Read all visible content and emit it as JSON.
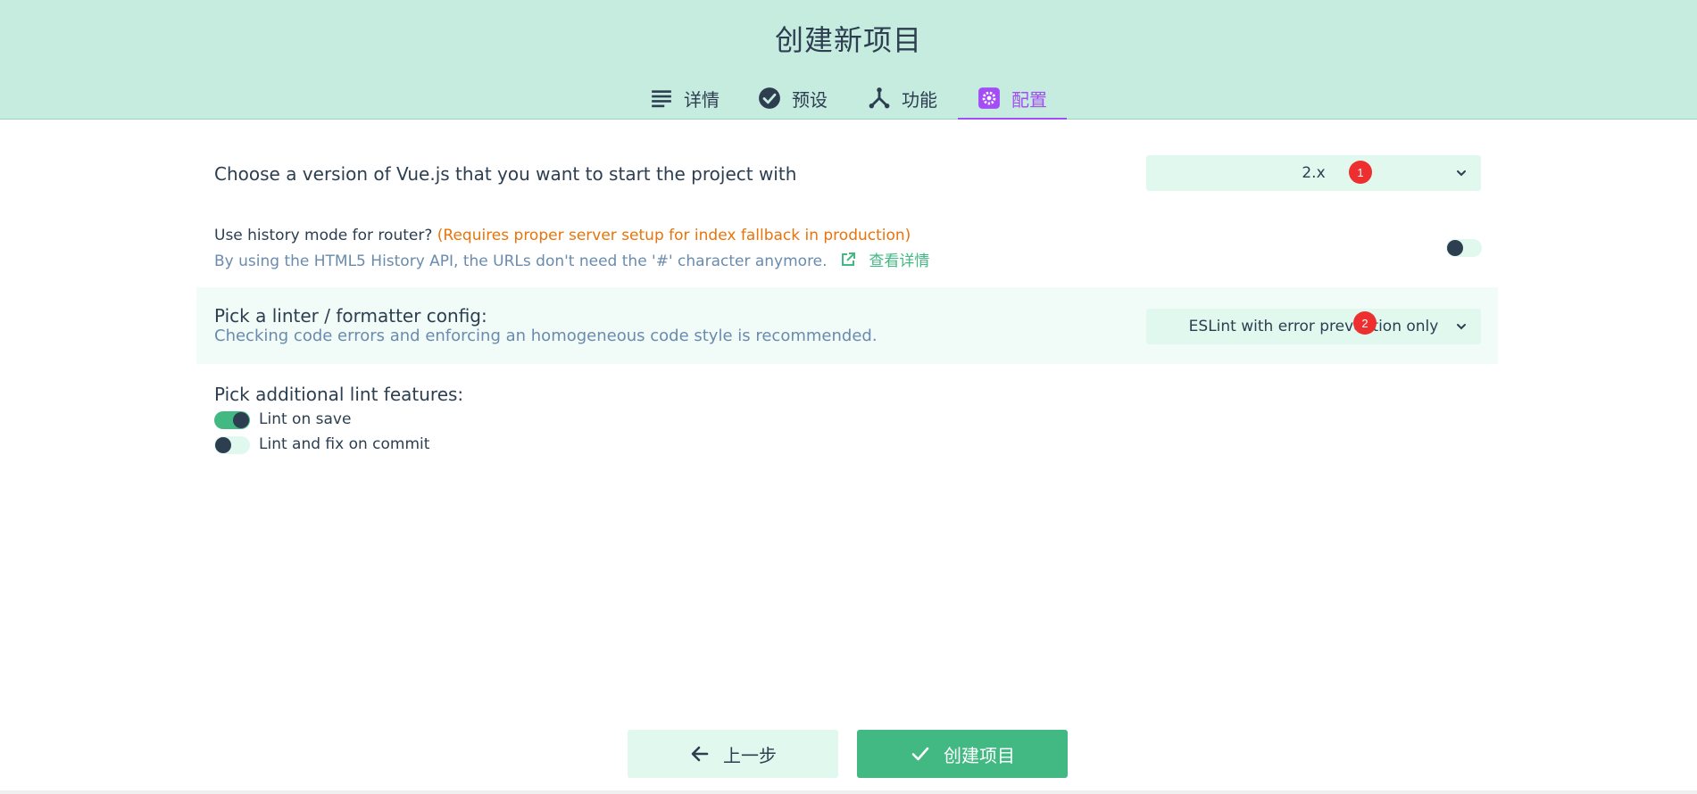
{
  "header": {
    "title": "创建新项目",
    "tabs": [
      {
        "label": "详情",
        "icon": "list-icon"
      },
      {
        "label": "预设",
        "icon": "check-circle-icon"
      },
      {
        "label": "功能",
        "icon": "fork-icon"
      },
      {
        "label": "配置",
        "icon": "gear-icon",
        "active": true
      }
    ]
  },
  "config": {
    "vue_version": {
      "label": "Choose a version of Vue.js that you want to start the project with",
      "value": "2.x",
      "badge": "1"
    },
    "history_mode": {
      "label": "Use history mode for router?",
      "warning": "(Requires proper server setup for index fallback in production)",
      "description": "By using the HTML5 History API, the URLs don't need the '#' character anymore.",
      "link": "查看详情",
      "enabled": false
    },
    "linter": {
      "label": "Pick a linter / formatter config:",
      "description": "Checking code errors and enforcing an homogeneous code style is recommended.",
      "value": "ESLint with error prevention only",
      "badge": "2"
    },
    "lint_features": {
      "label": "Pick additional lint features:",
      "options": [
        {
          "label": "Lint on save",
          "enabled": true
        },
        {
          "label": "Lint and fix on commit",
          "enabled": false
        }
      ]
    }
  },
  "footer": {
    "prev_label": "上一步",
    "create_label": "创建项目"
  },
  "colors": {
    "header_bg": "#c6ebdf",
    "accent_purple": "#a44cf6",
    "accent_green": "#42b983",
    "warning_orange": "#e8740b",
    "badge_red": "#ee2f2f"
  }
}
